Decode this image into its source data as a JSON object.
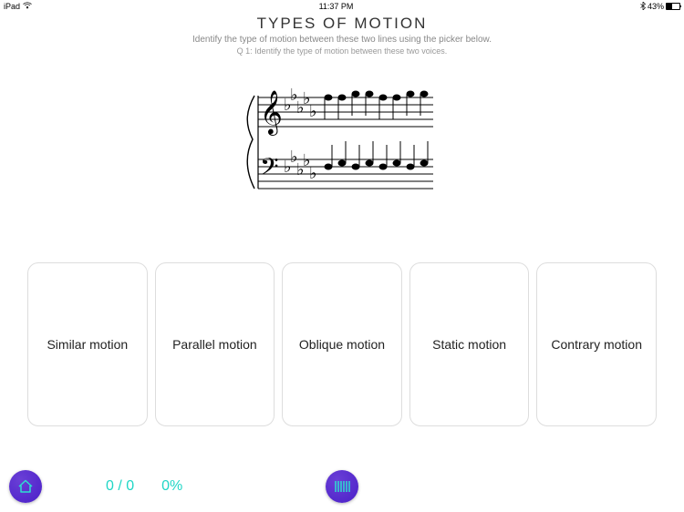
{
  "status": {
    "device": "iPad",
    "time": "11:37 PM",
    "bluetooth": true,
    "battery_percent": "43%"
  },
  "header": {
    "title": "TYPES OF MOTION",
    "subtitle": "Identify the type of motion between these two lines using the picker below.",
    "question": "Q 1: Identify the type of motion between these two voices."
  },
  "options": [
    "Similar motion",
    "Parallel motion",
    "Oblique motion",
    "Static motion",
    "Contrary motion"
  ],
  "footer": {
    "score": "0 / 0",
    "percent": "0%"
  },
  "icons": {
    "home": "home-icon",
    "keyboard": "piano-icon"
  },
  "notation": {
    "clefs": [
      "treble",
      "bass"
    ],
    "key_signature_flats": 5,
    "treble_line_positions": [
      4,
      4,
      4.5,
      4.5,
      4,
      4,
      4.5,
      4.5
    ],
    "bass_line_positions": [
      3,
      3.5,
      3,
      3.5,
      3,
      3.5,
      3,
      3.5
    ]
  }
}
